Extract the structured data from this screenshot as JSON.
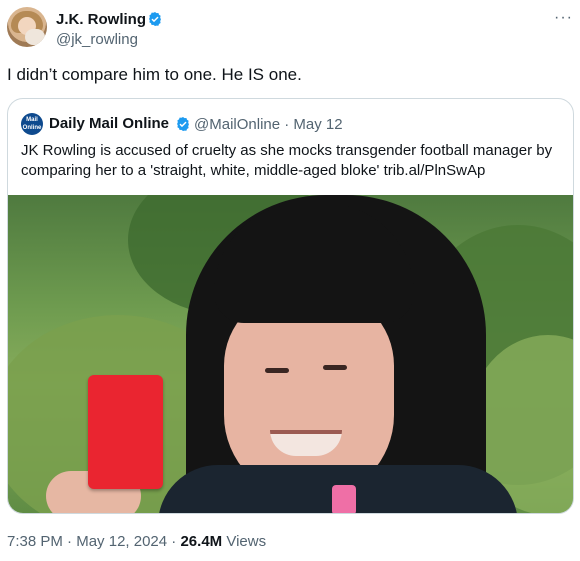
{
  "author": {
    "name": "J.K. Rowling",
    "handle": "@jk_rowling"
  },
  "tweet": {
    "text": "I didn’t compare him to one. He IS one."
  },
  "quoted": {
    "avatar_text": "Mail Online",
    "name": "Daily Mail Online",
    "handle_date": "@MailOnline · May 12",
    "text": "JK Rowling is accused of cruelty as she mocks transgender football manager by comparing her to a 'straight, white, middle-aged bloke' trib.al/PlnSwAp"
  },
  "meta": {
    "time": "7:38 PM",
    "sep1": " · ",
    "date": "May 12, 2024",
    "sep2": " · ",
    "views_count": "26.4M",
    "views_label": " Views"
  },
  "colors": {
    "verified": "#1d9bf0",
    "text_secondary": "#536471",
    "card_red": "#ea2530"
  },
  "icons": {
    "verified": "verified-badge-icon",
    "more": "more-dots-icon"
  }
}
